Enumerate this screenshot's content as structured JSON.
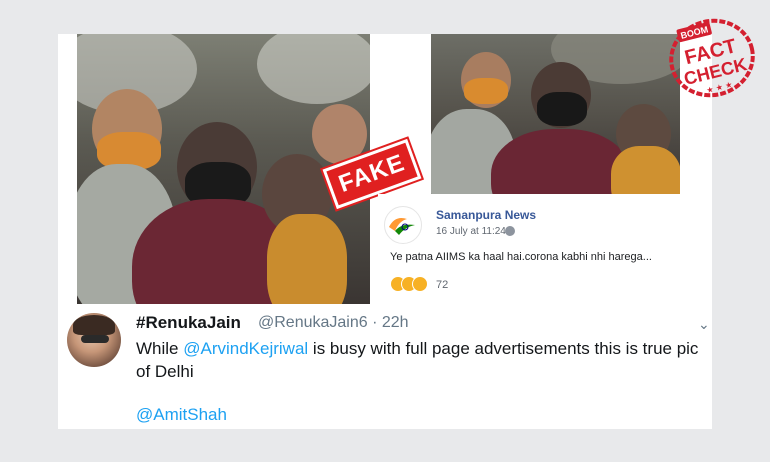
{
  "facebook_post": {
    "page_name": "Samanpura News",
    "date": "16 July at 11:24 ·",
    "text": "Ye patna AIIMS ka haal hai.corona kabhi nhi harega...",
    "reaction_count": "72"
  },
  "stamp": {
    "label": "FAKE"
  },
  "badge": {
    "brand": "BOOM",
    "line1": "FACT",
    "line2": "CHECK",
    "stars": "★ ★ ★"
  },
  "tweet": {
    "name": "#RenukaJain",
    "handle": "@RenukaJain6 · 22h",
    "text_part1": "While ",
    "mention1": "@ArvindKejriwal",
    "text_part2": " is busy with full page advertisements this is true pic of Delhi",
    "mention2": "@AmitShah",
    "menu_icon": "chevron-down-icon"
  },
  "colors": {
    "fake_red": "#e02020",
    "twitter_blue": "#1da1f2",
    "facebook_blue": "#385898",
    "badge_red": "#d42030"
  }
}
